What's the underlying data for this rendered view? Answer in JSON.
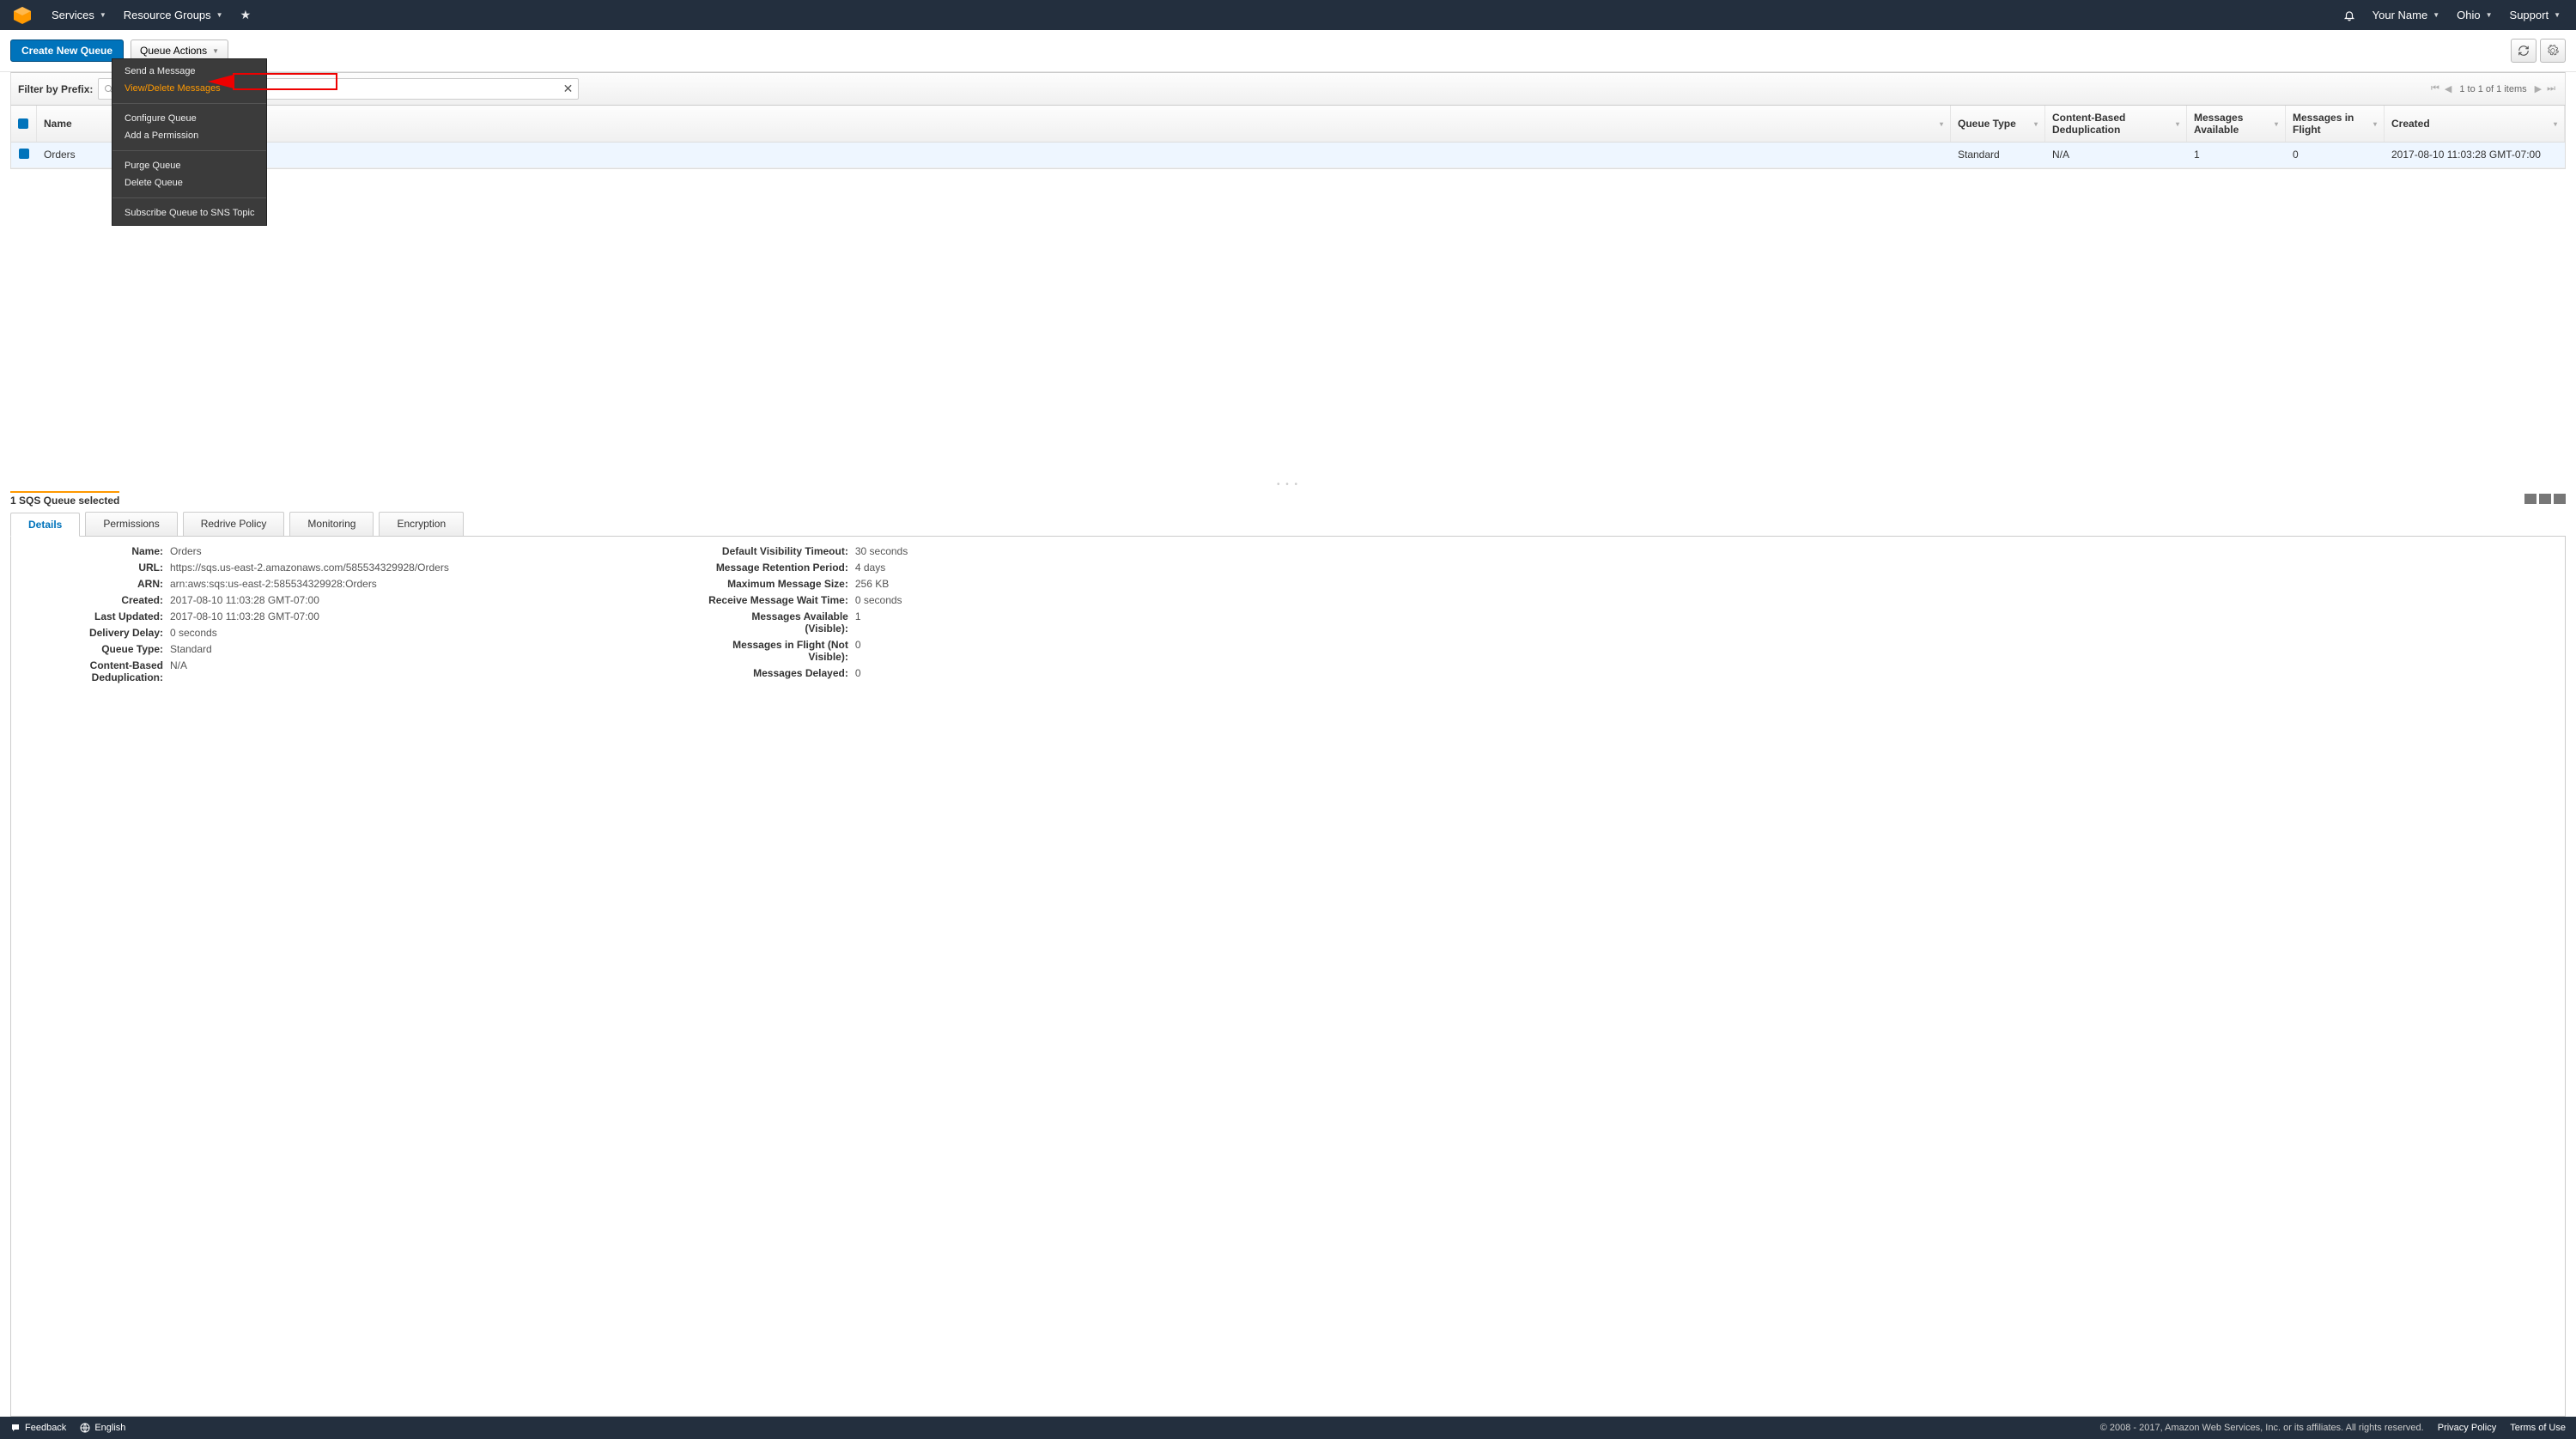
{
  "topbar": {
    "services": "Services",
    "resource_groups": "Resource Groups",
    "user": "Your Name",
    "region": "Ohio",
    "support": "Support"
  },
  "toolbar": {
    "create": "Create New Queue",
    "actions": "Queue Actions"
  },
  "menu": {
    "send": "Send a Message",
    "view_delete": "View/Delete Messages",
    "configure": "Configure Queue",
    "add_perm": "Add a Permission",
    "purge": "Purge Queue",
    "delete": "Delete Queue",
    "subscribe": "Subscribe Queue to SNS Topic"
  },
  "filter": {
    "label": "Filter by Prefix:",
    "placeholder": "Enter Text",
    "short_placeholder": "En"
  },
  "pager": {
    "text": "1 to 1 of 1 items"
  },
  "columns": {
    "name": "Name",
    "qtype": "Queue Type",
    "dedup": "Content-Based Deduplication",
    "avail": "Messages Available",
    "flight": "Messages in Flight",
    "created": "Created"
  },
  "rows": [
    {
      "name": "Orders",
      "qtype": "Standard",
      "dedup": "N/A",
      "avail": "1",
      "flight": "0",
      "created": "2017-08-10 11:03:28 GMT-07:00"
    }
  ],
  "selection": {
    "text": "1 SQS Queue selected"
  },
  "tabs": {
    "details": "Details",
    "permissions": "Permissions",
    "redrive": "Redrive Policy",
    "monitoring": "Monitoring",
    "encryption": "Encryption"
  },
  "details_left": {
    "name_l": "Name:",
    "name_v": "Orders",
    "url_l": "URL:",
    "url_v": "https://sqs.us-east-2.amazonaws.com/585534329928/Orders",
    "arn_l": "ARN:",
    "arn_v": "arn:aws:sqs:us-east-2:585534329928:Orders",
    "created_l": "Created:",
    "created_v": "2017-08-10 11:03:28 GMT-07:00",
    "updated_l": "Last Updated:",
    "updated_v": "2017-08-10 11:03:28 GMT-07:00",
    "delay_l": "Delivery Delay:",
    "delay_v": "0 seconds",
    "qtype_l": "Queue Type:",
    "qtype_v": "Standard",
    "dedup_l": "Content-Based Deduplication:",
    "dedup_v": "N/A"
  },
  "details_right": {
    "vis_l": "Default Visibility Timeout:",
    "vis_v": "30 seconds",
    "ret_l": "Message Retention Period:",
    "ret_v": "4 days",
    "max_l": "Maximum Message Size:",
    "max_v": "256 KB",
    "wait_l": "Receive Message Wait Time:",
    "wait_v": "0 seconds",
    "availv_l": "Messages Available (Visible):",
    "availv_v": "1",
    "flightn_l": "Messages in Flight (Not Visible):",
    "flightn_v": "0",
    "delayed_l": "Messages Delayed:",
    "delayed_v": "0"
  },
  "footer": {
    "feedback": "Feedback",
    "lang": "English",
    "copyright": "© 2008 - 2017, Amazon Web Services, Inc. or its affiliates. All rights reserved.",
    "privacy": "Privacy Policy",
    "terms": "Terms of Use"
  }
}
